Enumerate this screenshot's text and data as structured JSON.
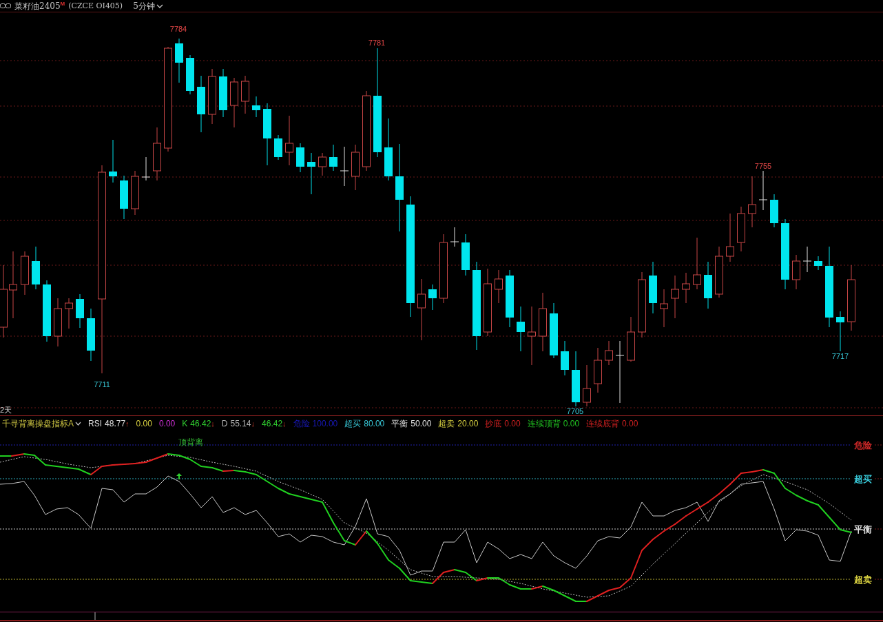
{
  "header": {
    "title": "菜籽油2405",
    "badge": "M",
    "code": "(CZCE OI405)",
    "period": "5分钟"
  },
  "price_chart": {
    "price_labels": [
      {
        "text": "7784",
        "kind": "high"
      },
      {
        "text": "7781",
        "kind": "high"
      },
      {
        "text": "7755",
        "kind": "high"
      },
      {
        "text": "7711",
        "kind": "low"
      },
      {
        "text": "7705",
        "kind": "low"
      },
      {
        "text": "7717",
        "kind": "low"
      }
    ],
    "range_label": "2天"
  },
  "indicator": {
    "name": "千寻背离操盘指标A",
    "legend": [
      {
        "label": "RSI",
        "value": "48.77",
        "arrow": "↑",
        "color": "#e0e0e0"
      },
      {
        "value": "0.00",
        "color": "#d8d040"
      },
      {
        "value": "0.00",
        "color": "#d030d8"
      },
      {
        "label": "K",
        "value": "46.42",
        "arrow": "↓",
        "color": "#30d030"
      },
      {
        "label": "D",
        "value": "55.14",
        "arrow": "↓",
        "color": "#b4b4b4"
      },
      {
        "value": "46.42",
        "arrow": "↓",
        "color": "#30d030"
      },
      {
        "label": "危险",
        "value": "100.00",
        "color": "#1818b8"
      },
      {
        "label": "超买",
        "value": "80.00",
        "color": "#38c8d8"
      },
      {
        "label": "平衡",
        "value": "50.00",
        "color": "#e0e0e0"
      },
      {
        "label": "超卖",
        "value": "20.00",
        "color": "#d8d040"
      },
      {
        "label": "抄底",
        "value": "0.00",
        "color": "#d02020"
      },
      {
        "label": "连续顶背",
        "value": "0.00",
        "color": "#20c020"
      },
      {
        "label": "连续底背",
        "value": "0.00",
        "color": "#d02020"
      }
    ],
    "signal_label": "顶背离",
    "levels": [
      {
        "label": "危险",
        "color": "#d02828"
      },
      {
        "label": "超买",
        "color": "#38c8d8"
      },
      {
        "label": "平衡",
        "color": "#e0e0e0"
      },
      {
        "label": "超卖",
        "color": "#d8d040"
      }
    ]
  }
}
